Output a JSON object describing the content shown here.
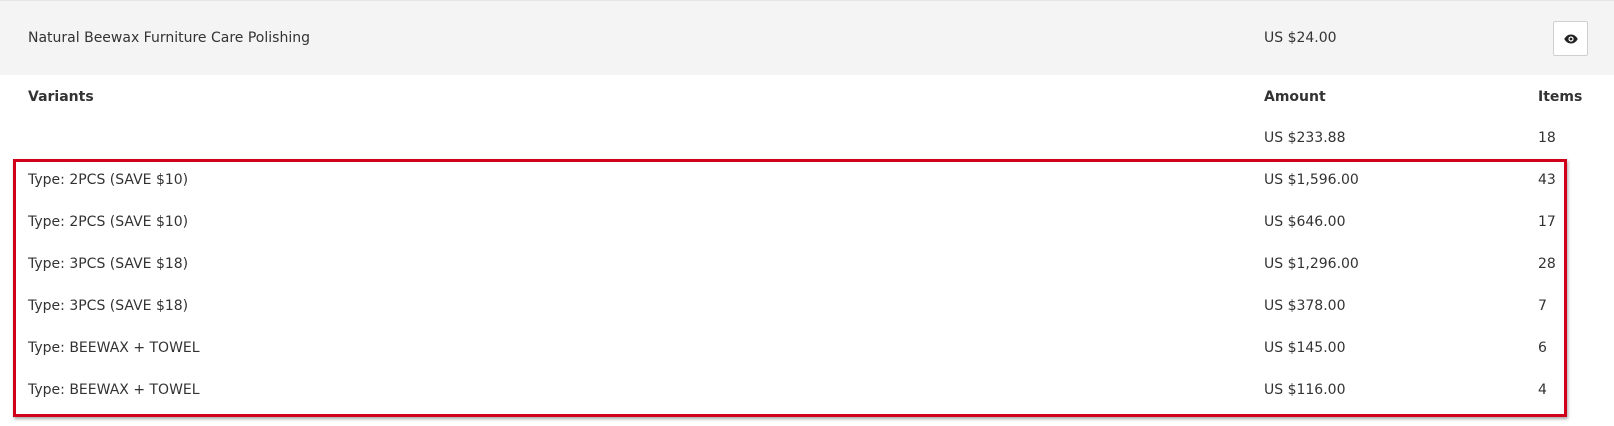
{
  "product": {
    "name": "Natural Beewax Furniture Care Polishing",
    "price": "US $24.00",
    "view_icon": "eye-icon"
  },
  "table": {
    "headers": {
      "variants": "Variants",
      "amount": "Amount",
      "items": "Items"
    },
    "rows": [
      {
        "variant": "",
        "amount": "US $233.88",
        "items": "18"
      },
      {
        "variant": "Type: 2PCS (SAVE $10)",
        "amount": "US $1,596.00",
        "items": "43"
      },
      {
        "variant": "Type: 2PCS (SAVE $10)",
        "amount": "US $646.00",
        "items": "17"
      },
      {
        "variant": "Type: 3PCS (SAVE $18)",
        "amount": "US $1,296.00",
        "items": "28"
      },
      {
        "variant": "Type: 3PCS (SAVE $18)",
        "amount": "US $378.00",
        "items": "7"
      },
      {
        "variant": "Type: BEEWAX + TOWEL",
        "amount": "US $145.00",
        "items": "6"
      },
      {
        "variant": "Type: BEEWAX + TOWEL",
        "amount": "US $116.00",
        "items": "4"
      }
    ]
  },
  "colors": {
    "highlight": "#d0021b",
    "product_row_bg": "#f4f4f4"
  }
}
